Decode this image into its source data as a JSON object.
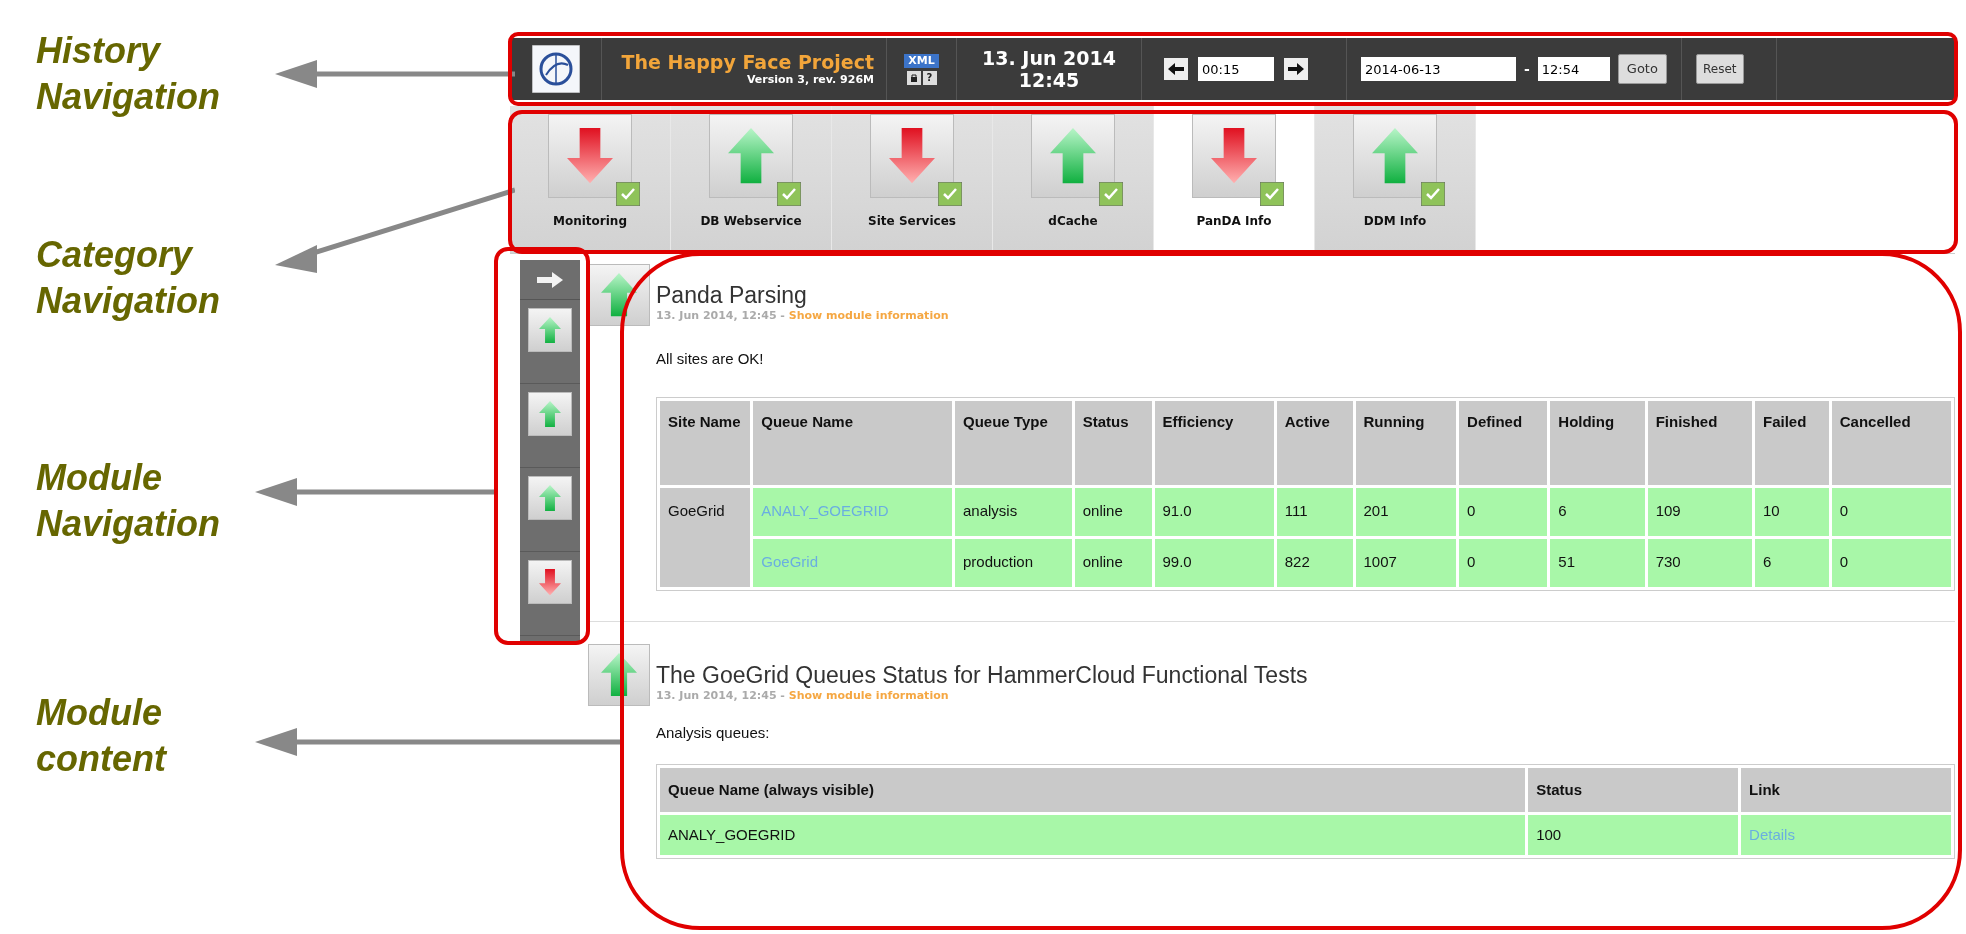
{
  "annotations": [
    {
      "label": "History Navigation",
      "kind": "history"
    },
    {
      "label": "Category Navigation",
      "kind": "category"
    },
    {
      "label": "Module Navigation",
      "kind": "module_nav"
    },
    {
      "label": "Module content",
      "kind": "content"
    }
  ],
  "header": {
    "title": "The Happy Face Project",
    "version": "Version 3, rev. 926M",
    "xml_badge": "XML",
    "help": "?",
    "date": "13. Jun 2014",
    "time": "12:45",
    "step": "00:15",
    "goto_date": "2014-06-13",
    "separator": "-",
    "goto_time": "12:54",
    "goto_button": "Goto",
    "reset_button": "Reset"
  },
  "categories": [
    {
      "label": "Monitoring",
      "kind": "down",
      "selected": false
    },
    {
      "label": "DB Webservice",
      "kind": "up",
      "selected": false
    },
    {
      "label": "Site Services",
      "kind": "down",
      "selected": false
    },
    {
      "label": "dCache",
      "kind": "up",
      "selected": false
    },
    {
      "label": "PanDA Info",
      "kind": "down",
      "selected": true
    },
    {
      "label": "DDM Info",
      "kind": "up",
      "selected": false
    }
  ],
  "module_nav": [
    {
      "kind": "up"
    },
    {
      "kind": "up"
    },
    {
      "kind": "up"
    },
    {
      "kind": "down"
    }
  ],
  "modules": [
    {
      "kind": "up",
      "title": "Panda Parsing",
      "timestamp": "13. Jun 2014, 12:45 -",
      "info_link": "Show module information",
      "message": "All sites are OK!",
      "table": {
        "columns": [
          "Site Name",
          "Queue Name",
          "Queue Type",
          "Status",
          "Efficiency",
          "Active",
          "Running",
          "Defined",
          "Holding",
          "Finished",
          "Failed",
          "Cancelled"
        ],
        "site_name": "GoeGrid",
        "rows": [
          {
            "queue": "ANALY_GOEGRID",
            "values": [
              "analysis",
              "online",
              "91.0",
              "111",
              "201",
              "0",
              "6",
              "109",
              "10",
              "0"
            ]
          },
          {
            "queue": "GoeGrid",
            "values": [
              "production",
              "online",
              "99.0",
              "822",
              "1007",
              "0",
              "51",
              "730",
              "6",
              "0"
            ]
          }
        ]
      }
    },
    {
      "kind": "up",
      "title": "The GoeGrid Queues Status for HammerCloud Functional Tests",
      "timestamp": "13. Jun 2014, 12:45 -",
      "info_link": "Show module information",
      "message": "Analysis queues:",
      "queue_table": {
        "columns": [
          "Queue Name (always visible)",
          "Status",
          "Link"
        ],
        "rows": [
          {
            "queue": "ANALY_GOEGRID",
            "status": "100",
            "link": "Details"
          }
        ]
      }
    }
  ]
}
